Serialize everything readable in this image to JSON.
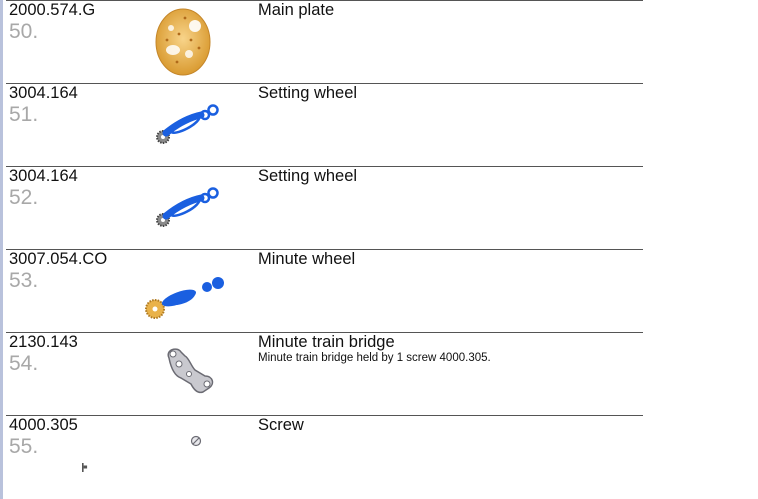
{
  "parts": [
    {
      "code": "2000.574.G",
      "number": "50.",
      "name": "Main plate",
      "description": "",
      "image": "main-plate-icon"
    },
    {
      "code": "3004.164",
      "number": "51.",
      "name": "Setting wheel",
      "description": "",
      "image": "setting-wheel-icon"
    },
    {
      "code": "3004.164",
      "number": "52.",
      "name": "Setting wheel",
      "description": "",
      "image": "setting-wheel-icon"
    },
    {
      "code": "3007.054.CO",
      "number": "53.",
      "name": "Minute wheel",
      "description": "",
      "image": "minute-wheel-icon"
    },
    {
      "code": "2130.143",
      "number": "54.",
      "name": "Minute train bridge",
      "description": "Minute train bridge held by 1 screw 4000.305.",
      "image": "minute-train-bridge-icon"
    },
    {
      "code": "4000.305",
      "number": "55.",
      "name": "Screw",
      "description": "",
      "image": "screw-icon"
    }
  ],
  "colors": {
    "number_text": "#a8a8a8",
    "divider": "#555555",
    "left_bar": "#b9c2dc",
    "highlight_blue": "#1a5fe0",
    "gold": "#e9b24a"
  }
}
